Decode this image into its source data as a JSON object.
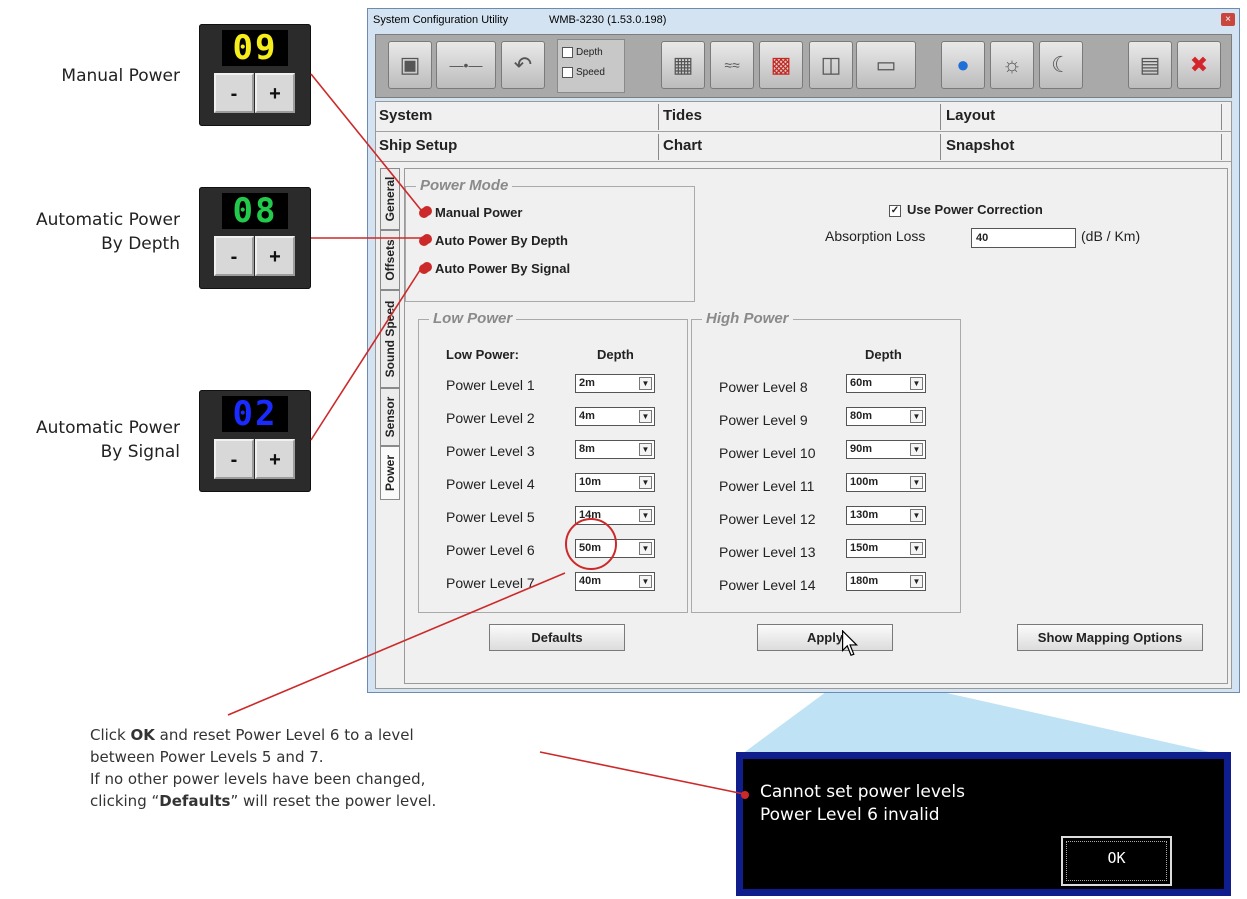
{
  "annotations": {
    "manual_power_label": "Manual Power",
    "auto_depth_label_1": "Automatic Power",
    "auto_depth_label_2": "By Depth",
    "auto_signal_label_1": "Automatic Power",
    "auto_signal_label_2": "By Signal",
    "widgets": [
      {
        "digits": "09",
        "color": "#f5ee1a",
        "minus": "-",
        "plus": "+"
      },
      {
        "digits": "08",
        "color": "#22c94a",
        "minus": "-",
        "plus": "+"
      },
      {
        "digits": "02",
        "color": "#1a2bff",
        "minus": "-",
        "plus": "+"
      }
    ],
    "note_line1_pre": "Click ",
    "note_line1_bold": "OK",
    "note_line1_post": " and reset Power Level 6 to a level",
    "note_line2": "between Power Levels 5 and 7.",
    "note_line3": "If no other power levels have been changed,",
    "note_line4_pre": "clicking “",
    "note_line4_bold": "Defaults",
    "note_line4_post": "” will reset the power level."
  },
  "window": {
    "title": "System Configuration Utility",
    "subtitle": "WMB-3230 (1.53.0.198)",
    "close": "×",
    "toolbar": {
      "depth_check": "Depth",
      "speed_check": "Speed"
    }
  },
  "tabs_row1": [
    "System",
    "Tides",
    "Layout"
  ],
  "tabs_row2": [
    "Ship Setup",
    "Chart",
    "Snapshot"
  ],
  "vertical_tabs": [
    "General",
    "Offsets",
    "Sound Speed",
    "Sensor",
    "Power"
  ],
  "power_mode": {
    "title": "Power Mode",
    "options": [
      "Manual Power",
      "Auto Power By Depth",
      "Auto Power By Signal"
    ]
  },
  "correction": {
    "checkbox_label": "Use Power Correction",
    "checked_mark": "✓",
    "absorption_label": "Absorption Loss",
    "absorption_value": "40",
    "absorption_unit": "(dB / Km)"
  },
  "low_power": {
    "title": "Low Power",
    "header_left": "Low Power:",
    "header_right": "Depth",
    "levels": [
      {
        "label": "Power Level 1",
        "value": "2m"
      },
      {
        "label": "Power Level 2",
        "value": "4m"
      },
      {
        "label": "Power Level 3",
        "value": "8m"
      },
      {
        "label": "Power Level 4",
        "value": "10m"
      },
      {
        "label": "Power Level 5",
        "value": "14m"
      },
      {
        "label": "Power Level 6",
        "value": "50m"
      },
      {
        "label": "Power Level 7",
        "value": "40m"
      }
    ]
  },
  "high_power": {
    "title": "High Power",
    "header_right": "Depth",
    "levels": [
      {
        "label": "Power Level 8",
        "value": "60m"
      },
      {
        "label": "Power Level 9",
        "value": "80m"
      },
      {
        "label": "Power Level 10",
        "value": "90m"
      },
      {
        "label": "Power Level 11",
        "value": "100m"
      },
      {
        "label": "Power Level 12",
        "value": "130m"
      },
      {
        "label": "Power Level 13",
        "value": "150m"
      },
      {
        "label": "Power Level 14",
        "value": "180m"
      }
    ]
  },
  "buttons": {
    "defaults": "Defaults",
    "apply": "Apply",
    "mapping": "Show Mapping Options"
  },
  "dialog": {
    "line1": "Cannot set power levels",
    "line2": "Power Level 6 invalid",
    "ok": "OK"
  },
  "colors": {
    "callout_red": "#cc2a2a",
    "dialog_border": "#0f1e8c",
    "callout_fill": "#bfe3f5"
  }
}
